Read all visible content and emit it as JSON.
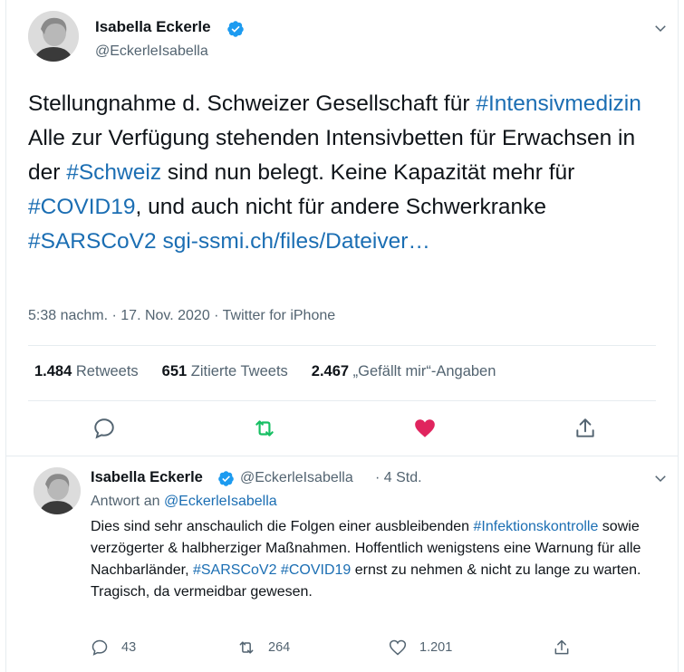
{
  "main_tweet": {
    "author_name": "Isabella Eckerle",
    "author_handle": "@EckerleIsabella",
    "text_parts": [
      {
        "text": "Stellungnahme d. Schweizer Gesellschaft für ",
        "tag": false
      },
      {
        "text": "#Intensivmedizin",
        "tag": true
      },
      {
        "text": " Alle zur Verfügung stehenden Intensivbetten für Erwachsen in der ",
        "tag": false
      },
      {
        "text": "#Schweiz",
        "tag": true
      },
      {
        "text": " sind nun belegt. Keine Kapazität mehr für ",
        "tag": false
      },
      {
        "text": "#COVID19",
        "tag": true
      },
      {
        "text": ", und auch nicht für andere Schwerkranke ",
        "tag": false
      },
      {
        "text": "#SARSCoV2",
        "tag": true
      },
      {
        "text": " ",
        "tag": false
      },
      {
        "text": "sgi-ssmi.ch/files/Dateiver…",
        "tag": true
      }
    ],
    "meta": "5:38 nachm. · 17. Nov. 2020 · Twitter for iPhone",
    "retweets_count": "1.484",
    "retweets_label": "Retweets",
    "quotes_count": "651",
    "quotes_label": "Zitierte Tweets",
    "likes_count": "2.467",
    "likes_label": "„Gefällt mir“-Angaben"
  },
  "reply_tweet": {
    "author_name": "Isabella Eckerle",
    "author_handle": "@EckerleIsabella",
    "time": "· 4 Std.",
    "reply_prefix": "Antwort an",
    "reply_to": "@EckerleIsabella",
    "text_parts": [
      {
        "text": "Dies sind sehr anschaulich die Folgen einer ausbleibenden ",
        "tag": false
      },
      {
        "text": "#Infektionskontrolle",
        "tag": true
      },
      {
        "text": " sowie verzögerter & halbherziger Maßnahmen. Hoffentlich wenigstens eine Warnung für alle Nachbarländer, ",
        "tag": false
      },
      {
        "text": "#SARSCoV2",
        "tag": true
      },
      {
        "text": " ",
        "tag": false
      },
      {
        "text": "#COVID19",
        "tag": true
      },
      {
        "text": " ernst zu nehmen & nicht zu lange zu warten. Tragisch, da vermeidbar gewesen.",
        "tag": false
      }
    ],
    "reply_count": "43",
    "retweet_count": "264",
    "like_count": "1.201"
  },
  "colors": {
    "link": "#1b6eb3",
    "retweet_green": "#17bf63",
    "like_red": "#e0245e",
    "secondary_text": "#536471",
    "verified_blue": "#1d9bf0"
  },
  "icons": [
    "verified-badge-icon",
    "chevron-down-icon",
    "reply-icon",
    "retweet-icon",
    "like-icon",
    "share-icon"
  ]
}
